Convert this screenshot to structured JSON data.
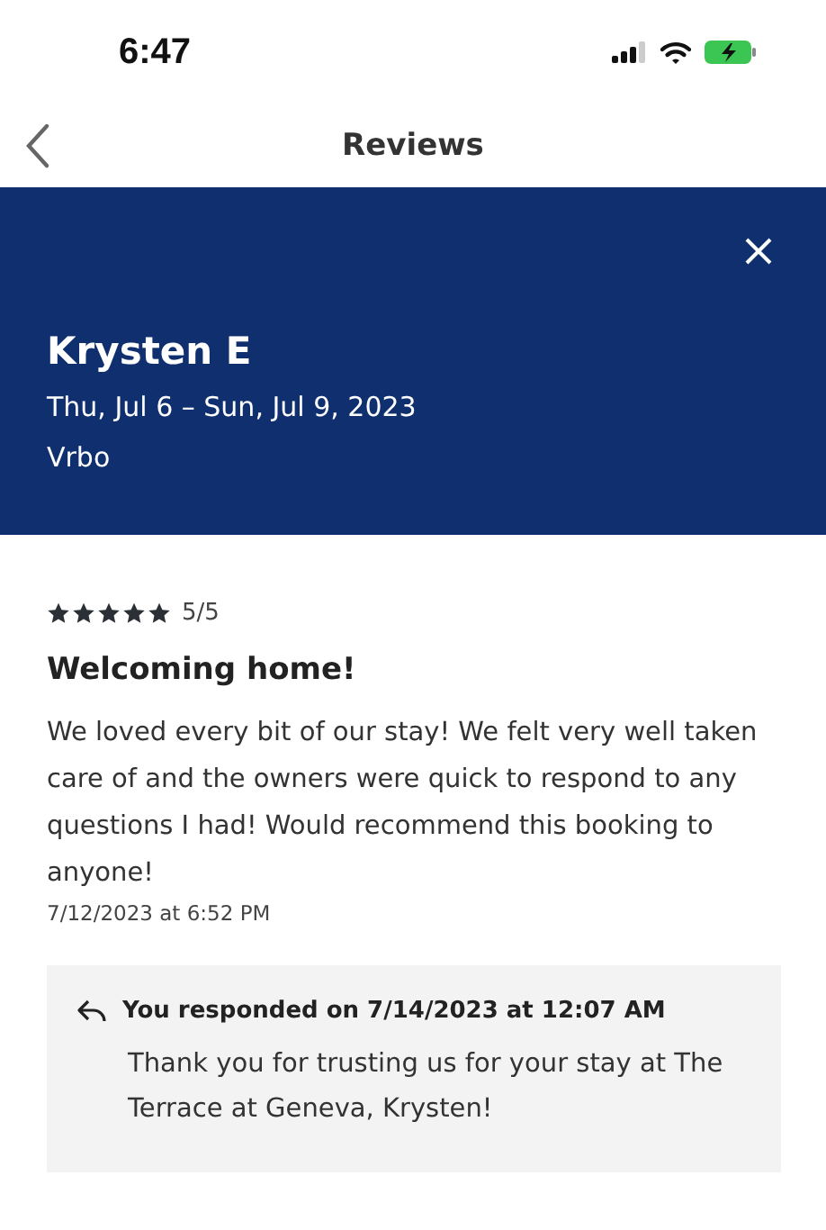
{
  "status_bar": {
    "time": "6:47"
  },
  "nav": {
    "title": "Reviews"
  },
  "header": {
    "name": "Krysten E",
    "dates": "Thu, Jul 6 – Sun, Jul 9, 2023",
    "source": "Vrbo"
  },
  "review": {
    "stars": 5,
    "score": "5/5",
    "title": "Welcoming home!",
    "body": "We loved every bit of our stay! We felt very well taken care of and the owners were quick to respond to any questions I had! Would recommend this booking to anyone!",
    "date": "7/12/2023 at 6:52 PM"
  },
  "response": {
    "heading": "You responded on 7/14/2023 at 12:07 AM",
    "body": "Thank you for trusting us for your stay at The Terrace at Geneva, Krysten!"
  }
}
